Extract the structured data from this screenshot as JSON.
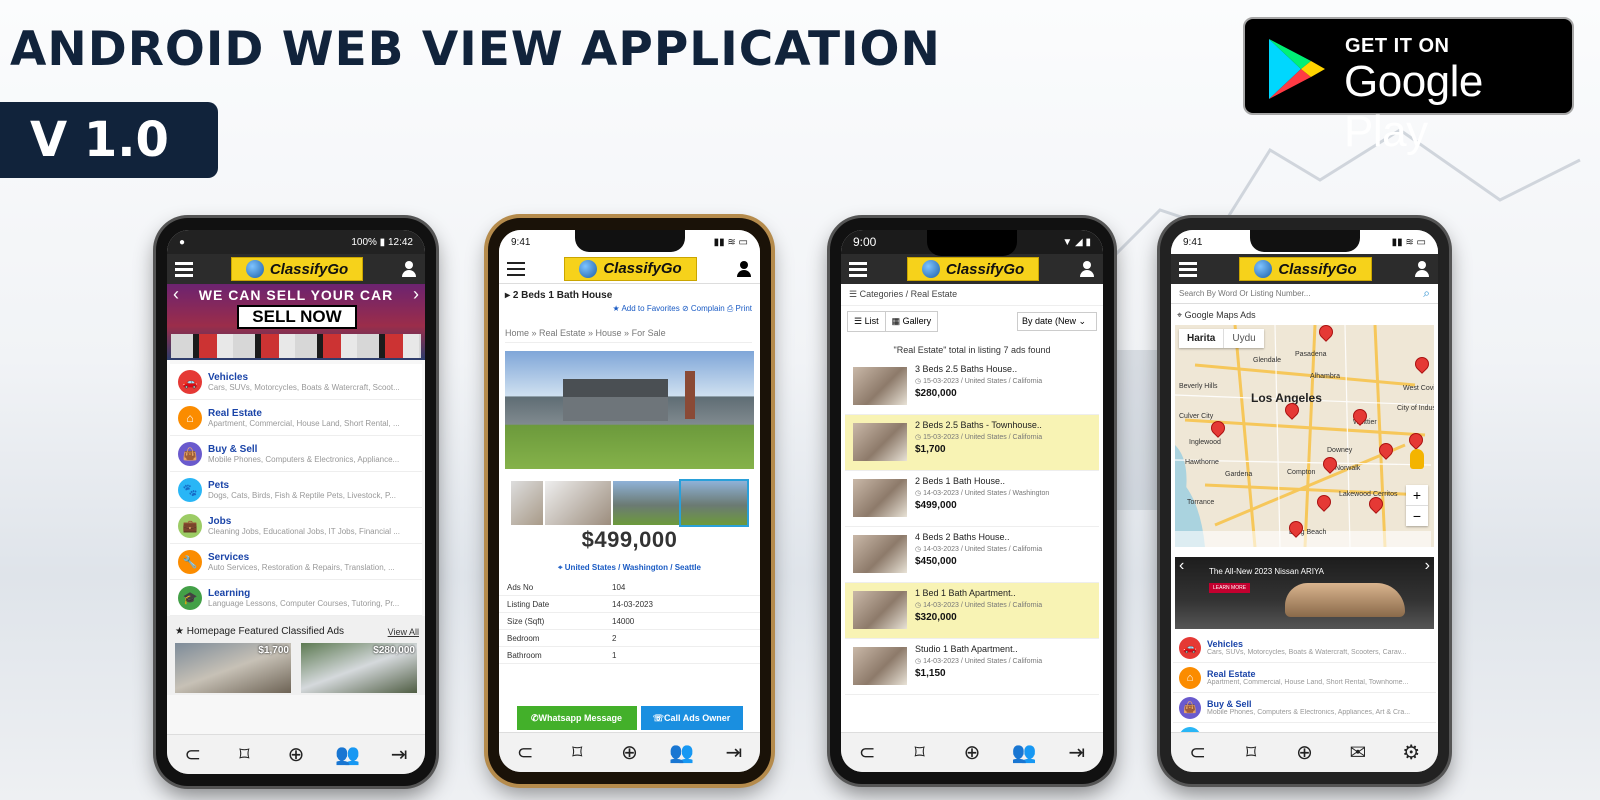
{
  "header": {
    "title": "ANDROID WEB VIEW APPLICATION",
    "version": "V 1.0"
  },
  "store_badge": {
    "small": "GET IT ON",
    "big": "Google Play"
  },
  "app": {
    "logo": "ClassifyGo"
  },
  "phone1": {
    "status_time": "12:42",
    "status_battery": "100%",
    "banner_top": "WE CAN SELL YOUR CAR",
    "banner_cta": "SELL NOW",
    "categories": [
      {
        "title": "Vehicles",
        "sub": "Cars, SUVs, Motorcycles, Boats & Watercraft, Scoot...",
        "color": "#e53935",
        "icon": "car-icon",
        "glyph": "🚗"
      },
      {
        "title": "Real Estate",
        "sub": "Apartment, Commercial, House Land, Short Rental, ...",
        "color": "#fb8c00",
        "icon": "home-icon",
        "glyph": "⌂"
      },
      {
        "title": "Buy & Sell",
        "sub": "Mobile Phones, Computers & Electronics, Appliance...",
        "color": "#6a5acd",
        "icon": "bag-icon",
        "glyph": "👜"
      },
      {
        "title": "Pets",
        "sub": "Dogs, Cats, Birds, Fish & Reptile Pets, Livestock, P...",
        "color": "#29b6f6",
        "icon": "paw-icon",
        "glyph": "🐾"
      },
      {
        "title": "Jobs",
        "sub": "Cleaning Jobs, Educational Jobs, IT Jobs, Financial ...",
        "color": "#9ccc65",
        "icon": "briefcase-icon",
        "glyph": "💼"
      },
      {
        "title": "Services",
        "sub": "Auto Services, Restoration & Repairs, Translation, ...",
        "color": "#fb8c00",
        "icon": "wrench-icon",
        "glyph": "🔧"
      },
      {
        "title": "Learning",
        "sub": "Language Lessons, Computer Courses, Tutoring, Pr...",
        "color": "#43a047",
        "icon": "graduation-icon",
        "glyph": "🎓"
      }
    ],
    "featured_title": "Homepage Featured Classified Ads",
    "view_all": "View All",
    "featured_prices": [
      "$1,700",
      "$280,000"
    ]
  },
  "phone2": {
    "status_time": "9:41",
    "listing_title": "2 Beds 1 Bath House",
    "actions": [
      "Add to Favorites",
      "Complain",
      "Print"
    ],
    "breadcrumb": "Home » Real Estate » House » For Sale",
    "price": "$499,000",
    "location": "United States / Washington / Seattle",
    "details": [
      {
        "k": "Ads No",
        "v": "104"
      },
      {
        "k": "Listing Date",
        "v": "14-03-2023"
      },
      {
        "k": "Size (Sqft)",
        "v": "14000"
      },
      {
        "k": "Bedroom",
        "v": "2"
      },
      {
        "k": "Bathroom",
        "v": "1"
      }
    ],
    "whatsapp_btn": "Whatsapp Message",
    "call_btn": "Call Ads Owner"
  },
  "phone3": {
    "status_time": "9:00",
    "breadcrumb": "Categories / Real Estate",
    "view_list": "List",
    "view_gallery": "Gallery",
    "sort": "By date (New",
    "summary": "\"Real Estate\" total in listing 7 ads found",
    "listings": [
      {
        "title": "3 Beds 2.5 Baths House..",
        "meta": "15-03-2023 / United States / California",
        "price": "$280,000",
        "hl": false
      },
      {
        "title": "2 Beds 2.5 Baths - Townhouse..",
        "meta": "15-03-2023 / United States / California",
        "price": "$1,700",
        "hl": true
      },
      {
        "title": "2 Beds 1 Bath House..",
        "meta": "14-03-2023 / United States / Washington",
        "price": "$499,000",
        "hl": false
      },
      {
        "title": "4 Beds 2 Baths House..",
        "meta": "14-03-2023 / United States / California",
        "price": "$450,000",
        "hl": false
      },
      {
        "title": "1 Bed 1 Bath Apartment..",
        "meta": "14-03-2023 / United States / California",
        "price": "$320,000",
        "hl": true
      },
      {
        "title": "Studio 1 Bath Apartment..",
        "meta": "14-03-2023 / United States / California",
        "price": "$1,150",
        "hl": false
      }
    ]
  },
  "phone4": {
    "status_time": "9:41",
    "search_placeholder": "Search By Word Or Listing Number...",
    "maps_title": "Google Maps Ads",
    "map_tab1": "Harita",
    "map_tab2": "Uydu",
    "map_city": "Los Angeles",
    "map_labels": [
      "Pasadena",
      "Glendale",
      "Alhambra",
      "Beverly Hills",
      "Culver City",
      "Inglewood",
      "Hawthorne",
      "Gardena",
      "Torrance",
      "Compton",
      "Downey",
      "Norwalk",
      "Whittier",
      "West Covi",
      "City of Industry",
      "Lakewood",
      "Cerritos",
      "Long Beach"
    ],
    "ad_small": "The All-New 2023 Nissan ARIYA",
    "ad_btn": "LEARN MORE",
    "categories": [
      {
        "title": "Vehicles",
        "sub": "Cars, SUVs, Motorcycles, Boats & Watercraft, Scooters, Carav...",
        "color": "#e53935",
        "glyph": "🚗"
      },
      {
        "title": "Real Estate",
        "sub": "Apartment, Commercial, House Land, Short Rental, Townhome...",
        "color": "#fb8c00",
        "glyph": "⌂"
      },
      {
        "title": "Buy & Sell",
        "sub": "Mobile Phones, Computers & Electronics, Appliances, Art & Cra...",
        "color": "#6a5acd",
        "glyph": "👜"
      },
      {
        "title": "Pets",
        "sub": "",
        "color": "#29b6f6",
        "glyph": "🐾"
      }
    ]
  },
  "nav": {
    "back": "⊂",
    "bookmark": "⌑",
    "add": "⊕",
    "add_user": "👥",
    "login": "⇥",
    "mail": "✉",
    "settings": "⚙"
  }
}
